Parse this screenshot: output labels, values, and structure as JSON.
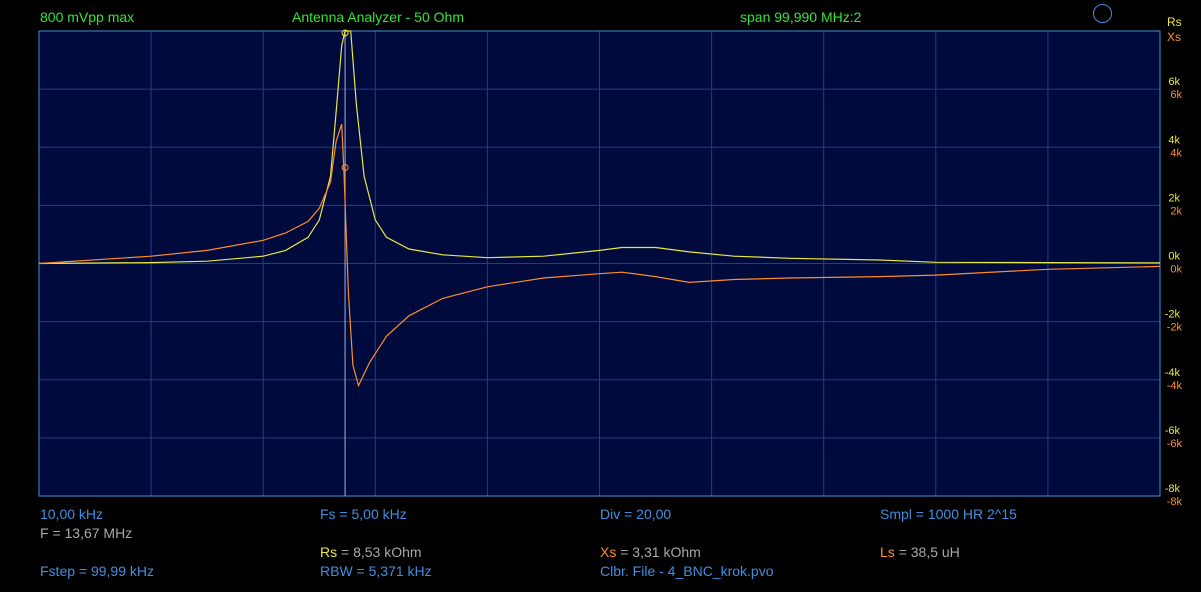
{
  "header": {
    "amplitude": "800 mVpp max",
    "title": "Antenna Analyzer - 50 Ohm",
    "span": "span 99,990 MHz:2"
  },
  "axis_labels": {
    "rs": "Rs",
    "xs": "Xs"
  },
  "readouts": {
    "freq_div": "10,00 kHz",
    "f": "F = 13,67 MHz",
    "fstep": "Fstep = 99,99 kHz",
    "fs": "Fs = 5,00 kHz",
    "rs_label": "Rs",
    "rs_value": "= 8,53 kOhm",
    "rbw": "RBW = 5,371 kHz",
    "div": "Div = 20,00",
    "xs_label": "Xs",
    "xs_value": "= 3,31 kOhm",
    "clbr": "Clbr. File - 4_BNC_krok.pvo",
    "smpl": "Smpl = 1000 HR  2^15",
    "ls_label": "Ls",
    "ls_value": "= 38,5 uH"
  },
  "colors": {
    "background": "#000000",
    "plot_bg": "#000a3c",
    "grid": "#1e3c96",
    "border": "#3f8fe0",
    "rs": "#e8e840",
    "xs": "#ff8c28",
    "header_text": "#32e632",
    "info_text": "#3f8fe0"
  },
  "icons": {
    "top_right": "circle-icon"
  },
  "chart_data": {
    "type": "line",
    "x_range": [
      0,
      99.99
    ],
    "ylim": [
      -8000,
      8000
    ],
    "grid": true,
    "cursor_x": 27.3,
    "rs_ticks": [
      "6k",
      "4k",
      "2k",
      "0k",
      "-2k",
      "-4k",
      "-6k",
      "-8k"
    ],
    "xs_ticks": [
      "6k",
      "4k",
      "2k",
      "0k",
      "-2k",
      "-4k",
      "-6k",
      "-8k"
    ],
    "series": [
      {
        "name": "Rs",
        "color": "#e8e840",
        "x": [
          0,
          10,
          15,
          20,
          22,
          24,
          25,
          26,
          26.5,
          27,
          27.3,
          27.8,
          28.3,
          29,
          30,
          31,
          33,
          36,
          40,
          45,
          50,
          52,
          55,
          58,
          62,
          67,
          75,
          80,
          90,
          99.99
        ],
        "y": [
          0,
          30,
          80,
          250,
          450,
          900,
          1500,
          3000,
          5200,
          7500,
          8000,
          8000,
          5500,
          3000,
          1500,
          900,
          500,
          300,
          200,
          250,
          450,
          550,
          550,
          400,
          250,
          180,
          120,
          40,
          30,
          20
        ]
      },
      {
        "name": "Xs",
        "color": "#ff8c28",
        "x": [
          0,
          10,
          15,
          20,
          22,
          24,
          25,
          26,
          26.5,
          27,
          27.2,
          27.6,
          28,
          28.5,
          29.5,
          31,
          33,
          36,
          40,
          45,
          50,
          52,
          55,
          58,
          62,
          67,
          75,
          80,
          90,
          99.99
        ],
        "y": [
          0,
          250,
          450,
          800,
          1050,
          1450,
          1900,
          2800,
          4200,
          4800,
          3200,
          -1000,
          -3500,
          -4200,
          -3400,
          -2500,
          -1800,
          -1200,
          -800,
          -500,
          -350,
          -300,
          -450,
          -650,
          -550,
          -500,
          -450,
          -400,
          -200,
          -100
        ]
      }
    ]
  }
}
